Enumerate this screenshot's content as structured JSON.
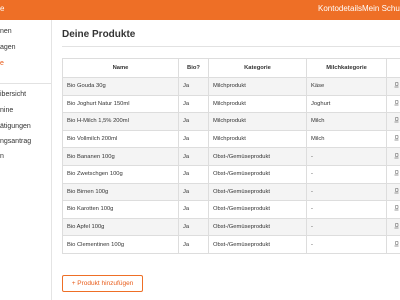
{
  "header": {
    "brand": "e",
    "links": [
      {
        "label": "Kontodetails"
      },
      {
        "label": "Mein Schulpr"
      }
    ]
  },
  "sidebar": {
    "items": [
      {
        "label": "nen"
      },
      {
        "label": "agen"
      },
      {
        "label": "e"
      },
      {
        "label": "ibersicht"
      },
      {
        "label": "nine"
      },
      {
        "label": "ätigungen"
      },
      {
        "label": "ngsantrag"
      },
      {
        "label": "n"
      }
    ]
  },
  "main": {
    "title": "Deine Produkte",
    "table": {
      "headers": [
        "Name",
        "Bio?",
        "Kategorie",
        "Milchkategorie",
        ""
      ],
      "rows": [
        {
          "name": "Bio Gouda 30g",
          "bio": "Ja",
          "category": "Milchprodukt",
          "milk_category": "Käse"
        },
        {
          "name": "Bio Joghurt Natur 150ml",
          "bio": "Ja",
          "category": "Milchprodukt",
          "milk_category": "Joghurt"
        },
        {
          "name": "Bio H-Milch 1,5% 200ml",
          "bio": "Ja",
          "category": "Milchprodukt",
          "milk_category": "Milch"
        },
        {
          "name": "Bio Vollmilch 200ml",
          "bio": "Ja",
          "category": "Milchprodukt",
          "milk_category": "Milch"
        },
        {
          "name": "Bio Bananen 100g",
          "bio": "Ja",
          "category": "Obst-/Gemüseprodukt",
          "milk_category": "-"
        },
        {
          "name": "Bio Zwetschgen 100g",
          "bio": "Ja",
          "category": "Obst-/Gemüseprodukt",
          "milk_category": "-"
        },
        {
          "name": "Bio Birnen 100g",
          "bio": "Ja",
          "category": "Obst-/Gemüseprodukt",
          "milk_category": "-"
        },
        {
          "name": "Bio Karotten 100g",
          "bio": "Ja",
          "category": "Obst-/Gemüseprodukt",
          "milk_category": "-"
        },
        {
          "name": "Bio Apfel 100g",
          "bio": "Ja",
          "category": "Obst-/Gemüseprodukt",
          "milk_category": "-"
        },
        {
          "name": "Bio Clementinen 100g",
          "bio": "Ja",
          "category": "Obst-/Gemüseprodukt",
          "milk_category": "-"
        }
      ],
      "row_action_icon": "edit-icon"
    },
    "add_button_label": "+ Produkt hinzufügen"
  },
  "colors": {
    "accent": "#ee6f26",
    "accent_text": "#e85c1a",
    "row_stripe": "#f4f4f4",
    "border": "#dddddd"
  }
}
